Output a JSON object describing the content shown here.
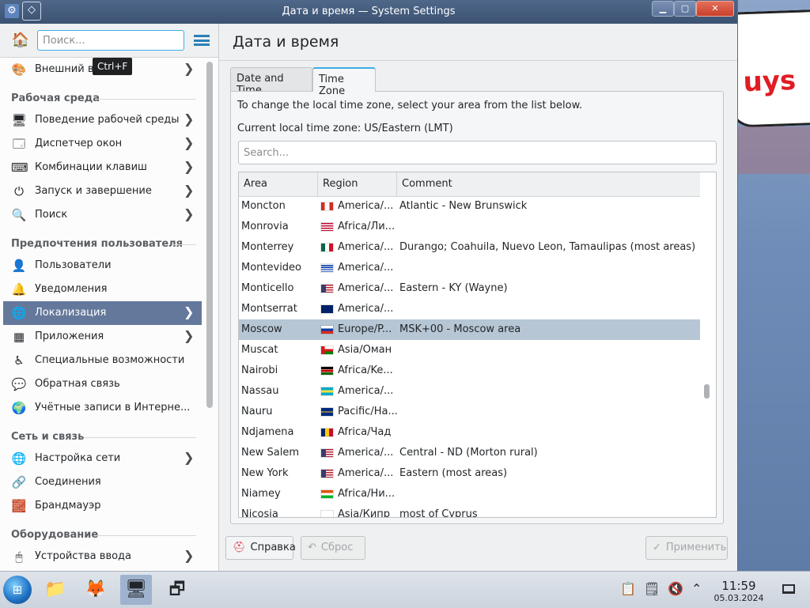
{
  "window": {
    "title": "Дата и время — System Settings",
    "min": "▁",
    "max": "▢",
    "close": "✕"
  },
  "sidebar": {
    "search_placeholder": "Поиск...",
    "tooltip": "Ctrl+F",
    "categories": {
      "workspace": "Рабочая среда",
      "personalization": "Предпочтения пользователя",
      "network": "Сеть и связь",
      "hardware": "Оборудование"
    },
    "items": [
      {
        "label": "Внешний вид",
        "icon": "appearance-icon"
      },
      {
        "label": "Поведение рабочей среды",
        "icon": "workspace-behavior-icon"
      },
      {
        "label": "Диспетчер окон",
        "icon": "window-manager-icon"
      },
      {
        "label": "Комбинации клавиш",
        "icon": "keyboard-icon"
      },
      {
        "label": "Запуск и завершение",
        "icon": "startup-icon"
      },
      {
        "label": "Поиск",
        "icon": "search-icon"
      },
      {
        "label": "Пользователи",
        "icon": "users-icon"
      },
      {
        "label": "Уведомления",
        "icon": "bell-icon"
      },
      {
        "label": "Локализация",
        "icon": "globe-icon"
      },
      {
        "label": "Приложения",
        "icon": "apps-icon"
      },
      {
        "label": "Специальные возможности",
        "icon": "accessibility-icon"
      },
      {
        "label": "Обратная связь",
        "icon": "feedback-icon"
      },
      {
        "label": "Учётные записи в Интерне...",
        "icon": "online-accounts-icon"
      },
      {
        "label": "Настройка сети",
        "icon": "network-icon"
      },
      {
        "label": "Соединения",
        "icon": "connections-icon"
      },
      {
        "label": "Брандмауэр",
        "icon": "firewall-icon"
      },
      {
        "label": "Устройства ввода",
        "icon": "mouse-icon"
      }
    ]
  },
  "main": {
    "title": "Дата и время",
    "tabs": [
      "Date and Time",
      "Time Zone"
    ],
    "info": "To change the local time zone, select your area from the list below.",
    "current": "Current local time zone: US/Eastern (LMT)",
    "search_placeholder": "Search...",
    "columns": [
      "Area",
      "Region",
      "Comment"
    ],
    "rows": [
      {
        "area": "Moncton",
        "region": "America/...",
        "comment": "Atlantic - New Brunswick",
        "flag": "ca"
      },
      {
        "area": "Monrovia",
        "region": "Africa/Ли...",
        "comment": "",
        "flag": "lr"
      },
      {
        "area": "Monterrey",
        "region": "America/...",
        "comment": "Durango; Coahuila, Nuevo Leon, Tamaulipas (most areas)",
        "flag": "mx"
      },
      {
        "area": "Montevideo",
        "region": "America/...",
        "comment": "",
        "flag": "uy"
      },
      {
        "area": "Monticello",
        "region": "America/...",
        "comment": "Eastern - KY (Wayne)",
        "flag": "us"
      },
      {
        "area": "Montserrat",
        "region": "America/...",
        "comment": "",
        "flag": "ms"
      },
      {
        "area": "Moscow",
        "region": "Europe/P...",
        "comment": "MSK+00 - Moscow area",
        "flag": "ru",
        "selected": true
      },
      {
        "area": "Muscat",
        "region": "Asia/Оман",
        "comment": "",
        "flag": "om"
      },
      {
        "area": "Nairobi",
        "region": "Africa/Ke...",
        "comment": "",
        "flag": "ke"
      },
      {
        "area": "Nassau",
        "region": "America/...",
        "comment": "",
        "flag": "bs"
      },
      {
        "area": "Nauru",
        "region": "Pacific/На...",
        "comment": "",
        "flag": "nr"
      },
      {
        "area": "Ndjamena",
        "region": "Africa/Чад",
        "comment": "",
        "flag": "td"
      },
      {
        "area": "New Salem",
        "region": "America/...",
        "comment": "Central - ND (Morton rural)",
        "flag": "us"
      },
      {
        "area": "New York",
        "region": "America/...",
        "comment": "Eastern (most areas)",
        "flag": "us"
      },
      {
        "area": "Niamey",
        "region": "Africa/Ни...",
        "comment": "",
        "flag": "ne"
      },
      {
        "area": "Nicosia",
        "region": "Asia/Кипр",
        "comment": "most of Cyprus",
        "flag": "cy"
      }
    ]
  },
  "buttons": {
    "help": "Справка",
    "reset": "Сброс",
    "apply": "Применить"
  },
  "taskbar": {
    "time": "11:59",
    "date": "05.03.2024"
  },
  "desktop": {
    "sign_text": "uys"
  },
  "colors": {
    "accent": "#3daee9",
    "selection": "#64789b",
    "row_selected": "#b6c6d4"
  }
}
